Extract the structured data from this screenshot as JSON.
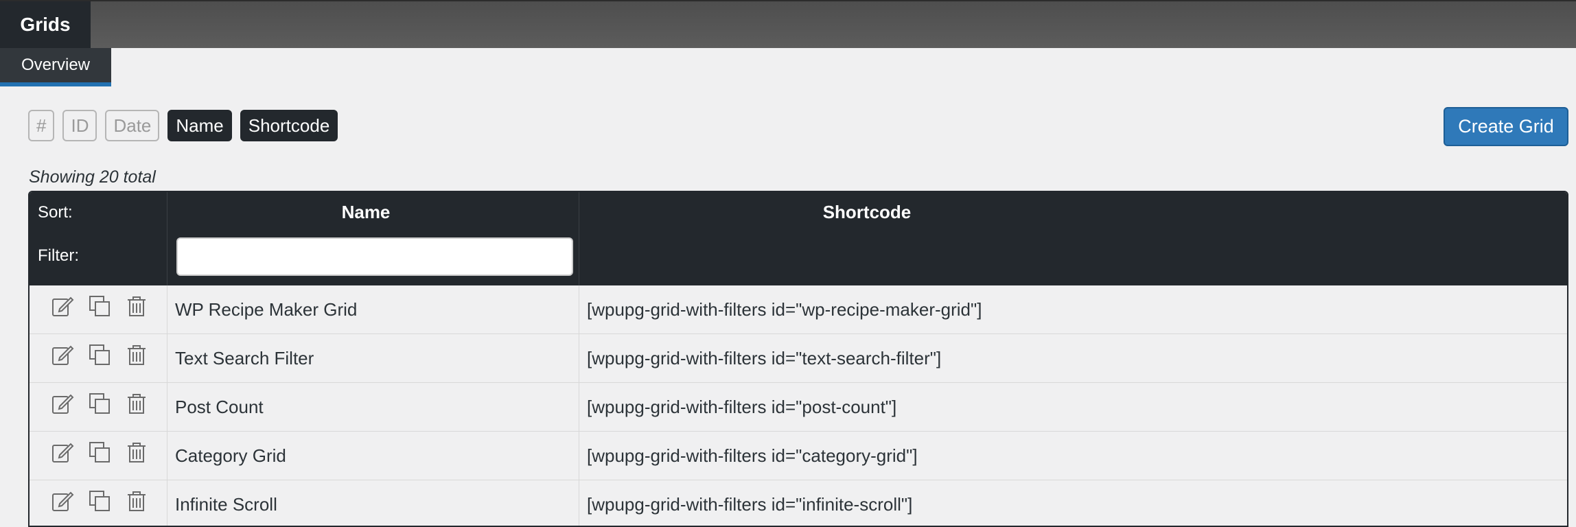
{
  "header": {
    "title": "Grids"
  },
  "subnav": {
    "active_tab": "Overview"
  },
  "column_toggles": [
    {
      "label": "#",
      "active": false
    },
    {
      "label": "ID",
      "active": false
    },
    {
      "label": "Date",
      "active": false
    },
    {
      "label": "Name",
      "active": true
    },
    {
      "label": "Shortcode",
      "active": true
    }
  ],
  "create_button": "Create Grid",
  "showing_text": "Showing 20 total",
  "table": {
    "sort_label": "Sort:",
    "filter_label": "Filter:",
    "columns": [
      "Name",
      "Shortcode"
    ],
    "filter_value": "",
    "rows": [
      {
        "name": "WP Recipe Maker Grid",
        "shortcode": "[wpupg-grid-with-filters id=\"wp-recipe-maker-grid\"]"
      },
      {
        "name": "Text Search Filter",
        "shortcode": "[wpupg-grid-with-filters id=\"text-search-filter\"]"
      },
      {
        "name": "Post Count",
        "shortcode": "[wpupg-grid-with-filters id=\"post-count\"]"
      },
      {
        "name": "Category Grid",
        "shortcode": "[wpupg-grid-with-filters id=\"category-grid\"]"
      },
      {
        "name": "Infinite Scroll",
        "shortcode": "[wpupg-grid-with-filters id=\"infinite-scroll\"]"
      }
    ],
    "row_actions": [
      "edit-icon",
      "duplicate-icon",
      "trash-icon"
    ]
  },
  "colors": {
    "accent": "#2271b1",
    "dark": "#23282d",
    "button": "#2f79b9"
  }
}
